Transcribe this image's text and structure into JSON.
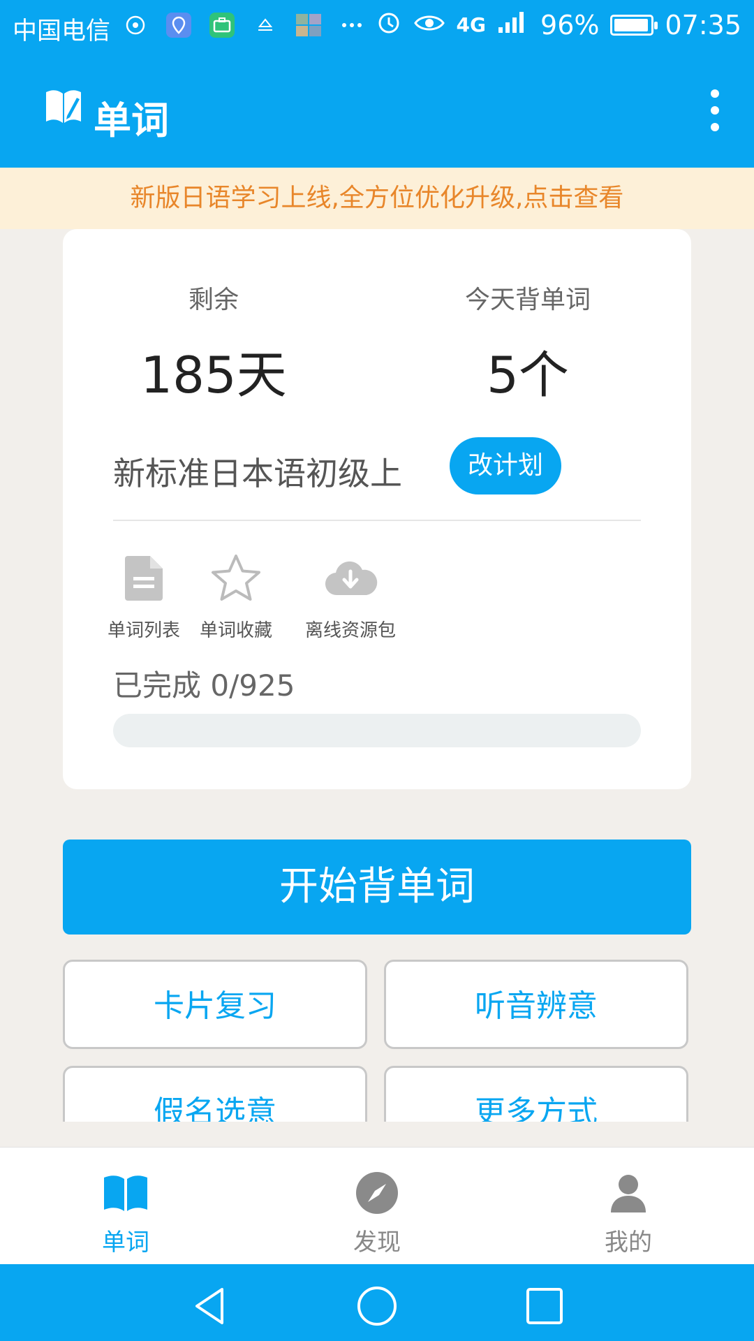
{
  "status_bar": {
    "carrier": "中国电信",
    "network": "4G",
    "battery": "96%",
    "battery_level": 0.96,
    "time": "07:35"
  },
  "app_bar": {
    "title": "单词",
    "logo_icon": "book-pen-icon",
    "menu_icon": "more-vertical-icon"
  },
  "banner": {
    "text": "新版日语学习上线,全方位优化升级,点击查看"
  },
  "stats": {
    "remaining_label": "剩余",
    "remaining_value": "185天",
    "today_label": "今天背单词",
    "today_value": "5个"
  },
  "plan": {
    "name": "新标准日本语初级上",
    "change_button": "改计划"
  },
  "tools": [
    {
      "label": "单词列表",
      "icon": "document-icon"
    },
    {
      "label": "单词收藏",
      "icon": "star-icon"
    },
    {
      "label": "离线资源包",
      "icon": "cloud-download-icon"
    }
  ],
  "progress": {
    "label": "已完成",
    "value": "0/925",
    "completed": 0,
    "total": 925
  },
  "start_button": "开始背单词",
  "modes": [
    "卡片复习",
    "听音辨意",
    "假名选意",
    "更多方式"
  ],
  "bottom_nav": [
    {
      "label": "单词",
      "icon": "book-icon",
      "active": true
    },
    {
      "label": "发现",
      "icon": "compass-icon",
      "active": false
    },
    {
      "label": "我的",
      "icon": "person-icon",
      "active": false
    }
  ],
  "colors": {
    "primary": "#08a6f1",
    "banner_bg": "#fdf0d8",
    "banner_text": "#e8862a",
    "inactive": "#888888"
  }
}
